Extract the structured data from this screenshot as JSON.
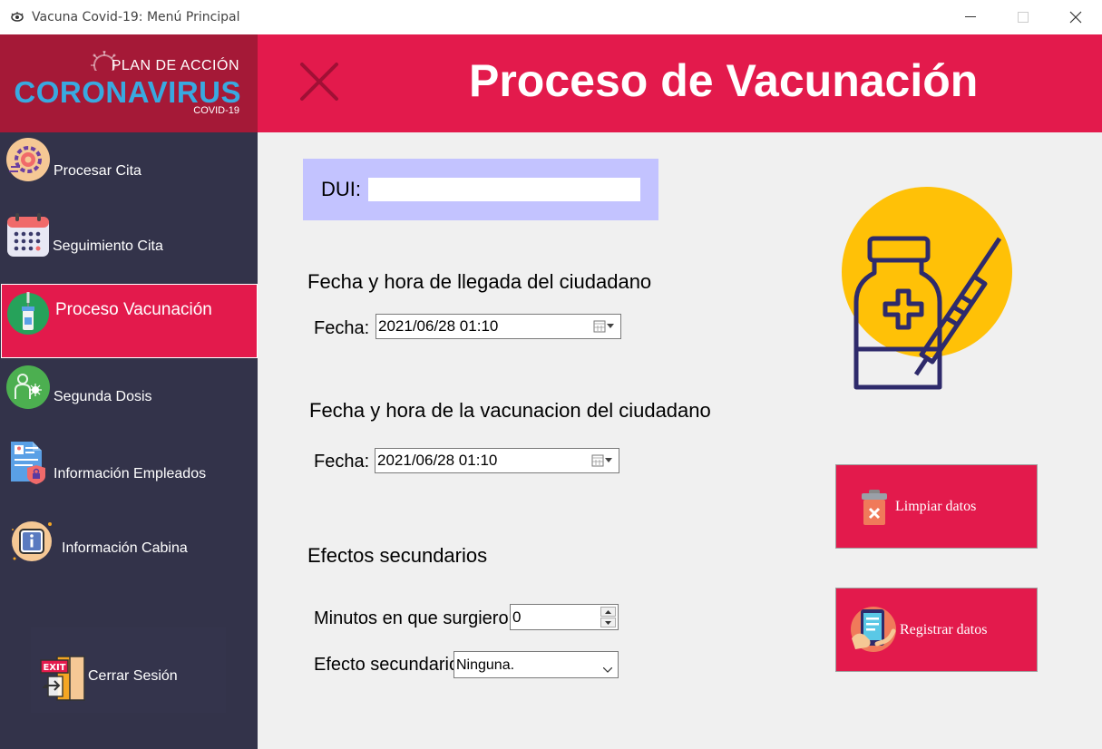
{
  "window": {
    "title": "Vacuna Covid-19: Menú Principal"
  },
  "logo": {
    "line1": "PLAN DE ACCIÓN",
    "line2": "CORONAVIRUS",
    "line3": "COVID-19"
  },
  "sidebar": {
    "items": [
      {
        "label": "Procesar Cita",
        "icon": "gear-icon"
      },
      {
        "label": "Seguimiento Cita",
        "icon": "calendar-icon"
      },
      {
        "label": "Proceso Vacunación",
        "icon": "vaccine-vial-icon",
        "active": true
      },
      {
        "label": "Segunda Dosis",
        "icon": "patient-icon"
      },
      {
        "label": "Información Empleados",
        "icon": "employee-document-icon"
      },
      {
        "label": "Información Cabina",
        "icon": "info-icon"
      }
    ],
    "logout": {
      "label": "Cerrar Sesión",
      "icon": "exit-door-icon"
    }
  },
  "header": {
    "title": "Proceso de Vacunación"
  },
  "form": {
    "dui": {
      "label": "DUI:",
      "value": ""
    },
    "arrival": {
      "heading": "Fecha y hora de llegada del ciudadano",
      "label": "Fecha:",
      "value": "2021/06/28 01:10"
    },
    "vaccination": {
      "heading": "Fecha y hora de la vacunacion del ciudadano",
      "label": "Fecha:",
      "value": "2021/06/28 01:10"
    },
    "side_effects": {
      "heading": "Efectos secundarios",
      "minutes_label": "Minutos en que surgieron",
      "minutes_value": "0",
      "effect_label": "Efecto secundario",
      "effect_value": "Ninguna."
    }
  },
  "buttons": {
    "clear": "Limpiar datos",
    "register": "Registrar datos"
  },
  "colors": {
    "accent": "#e31a4c",
    "sidebar": "#33334a",
    "logo_bg": "#a51937",
    "dui_bg": "#c3c3ff",
    "vaccine_circle": "#ffc107"
  }
}
